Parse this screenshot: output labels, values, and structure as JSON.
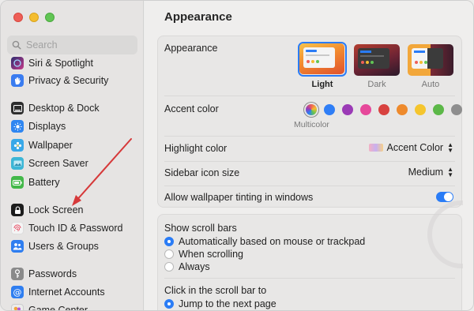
{
  "sidebar": {
    "search_placeholder": "Search",
    "items": [
      {
        "label": "Siri & Spotlight",
        "icon": "siri-icon",
        "color": "#7b4bd6"
      },
      {
        "label": "Privacy & Security",
        "icon": "hand-icon",
        "color": "#3a7cf0"
      },
      {
        "label": "Desktop & Dock",
        "icon": "dock-icon",
        "color": "#2d2d2d"
      },
      {
        "label": "Displays",
        "icon": "sun-icon",
        "color": "#2f86f1"
      },
      {
        "label": "Wallpaper",
        "icon": "flower-icon",
        "color": "#38a8e8"
      },
      {
        "label": "Screen Saver",
        "icon": "screensaver-icon",
        "color": "#3cb6d6"
      },
      {
        "label": "Battery",
        "icon": "battery-icon",
        "color": "#43b849"
      },
      {
        "label": "Lock Screen",
        "icon": "lock-icon",
        "color": "#1c1c1c"
      },
      {
        "label": "Touch ID & Password",
        "icon": "fingerprint-icon",
        "color": "#f2f2f2"
      },
      {
        "label": "Users & Groups",
        "icon": "users-icon",
        "color": "#2f7ef0"
      },
      {
        "label": "Passwords",
        "icon": "key-icon",
        "color": "#8a8a8a"
      },
      {
        "label": "Internet Accounts",
        "icon": "at-icon",
        "color": "#2f7ef0"
      },
      {
        "label": "Game Center",
        "icon": "gamecenter-icon",
        "color": "#e9e9e9"
      }
    ]
  },
  "main": {
    "title": "Appearance",
    "appearance": {
      "label": "Appearance",
      "options": [
        {
          "label": "Light",
          "selected": true
        },
        {
          "label": "Dark",
          "selected": false
        },
        {
          "label": "Auto",
          "selected": false
        }
      ]
    },
    "accent": {
      "label": "Accent color",
      "selected_name": "Multicolor",
      "colors": [
        "multicolor",
        "#2f7ef6",
        "#9b3bb6",
        "#e6489a",
        "#d8423f",
        "#ee8a2c",
        "#f5c52d",
        "#5cb848",
        "#8e8e8e"
      ]
    },
    "highlight": {
      "label": "Highlight color",
      "value": "Accent Color"
    },
    "sidebar_icon_size": {
      "label": "Sidebar icon size",
      "value": "Medium"
    },
    "wallpaper_tinting": {
      "label": "Allow wallpaper tinting in windows",
      "enabled": true
    },
    "scroll_bars": {
      "label": "Show scroll bars",
      "options": [
        {
          "label": "Automatically based on mouse or trackpad",
          "selected": true
        },
        {
          "label": "When scrolling",
          "selected": false
        },
        {
          "label": "Always",
          "selected": false
        }
      ]
    },
    "click_scroll": {
      "label": "Click in the scroll bar to",
      "options": [
        {
          "label": "Jump to the next page",
          "selected": true
        }
      ]
    }
  },
  "colors": {
    "accent": "#2a7cf6",
    "annotation_arrow": "#d6393a"
  }
}
